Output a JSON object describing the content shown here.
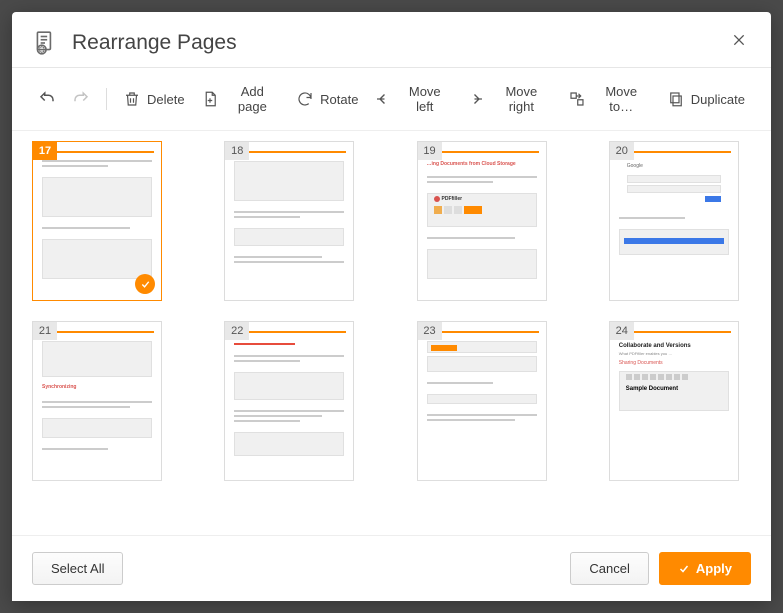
{
  "header": {
    "title": "Rearrange Pages"
  },
  "toolbar": {
    "delete_label": "Delete",
    "add_page_label": "Add page",
    "rotate_label": "Rotate",
    "move_left_label": "Move left",
    "move_right_label": "Move right",
    "move_to_label": "Move to…",
    "duplicate_label": "Duplicate"
  },
  "pages": [
    {
      "num": "17",
      "selected": true
    },
    {
      "num": "18",
      "selected": false
    },
    {
      "num": "19",
      "selected": false,
      "heading": "…ing Documents from Cloud Storage",
      "logo_text": "PDFfiller"
    },
    {
      "num": "20",
      "selected": false,
      "brand": "Google"
    },
    {
      "num": "21",
      "selected": false,
      "section": "Synchronizing"
    },
    {
      "num": "22",
      "selected": false
    },
    {
      "num": "23",
      "selected": false
    },
    {
      "num": "24",
      "selected": false,
      "headline": "Collaborate and Versions",
      "subhead": "Sharing Documents",
      "sample": "Sample Document"
    }
  ],
  "footer": {
    "select_all_label": "Select All",
    "cancel_label": "Cancel",
    "apply_label": "Apply"
  }
}
